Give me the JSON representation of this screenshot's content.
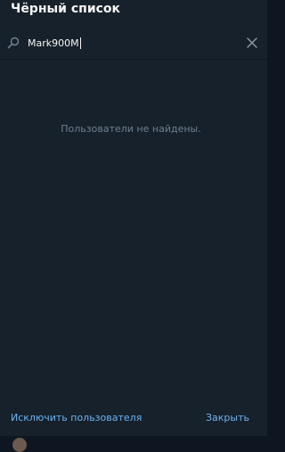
{
  "dialog": {
    "title": "Чёрный список",
    "search": {
      "value": "Mark900M",
      "icon": "search-icon",
      "clear_icon": "close-icon"
    },
    "empty_message": "Пользователи не найдены.",
    "buttons": {
      "exclude_user": "Исключить пользователя",
      "close": "Закрыть"
    }
  },
  "colors": {
    "dialog_bg": "#17212b",
    "window_bg": "#0e1621",
    "accent": "#6ab3f3",
    "muted_text": "#6d7f8f"
  }
}
